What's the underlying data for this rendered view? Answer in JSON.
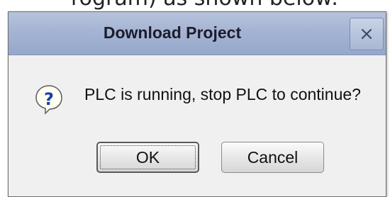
{
  "background_text": "rogram) as shown below:",
  "dialog": {
    "title": "Download Project",
    "close_glyph": "×",
    "icon": "question-icon",
    "message": "PLC is running, stop PLC to continue?",
    "buttons": {
      "ok_label": "OK",
      "cancel_label": "Cancel"
    }
  },
  "colors": {
    "titlebar": "#a5b4d3",
    "dialog_bg": "#f0f0f0",
    "question_mark": "#1f3fa8"
  }
}
